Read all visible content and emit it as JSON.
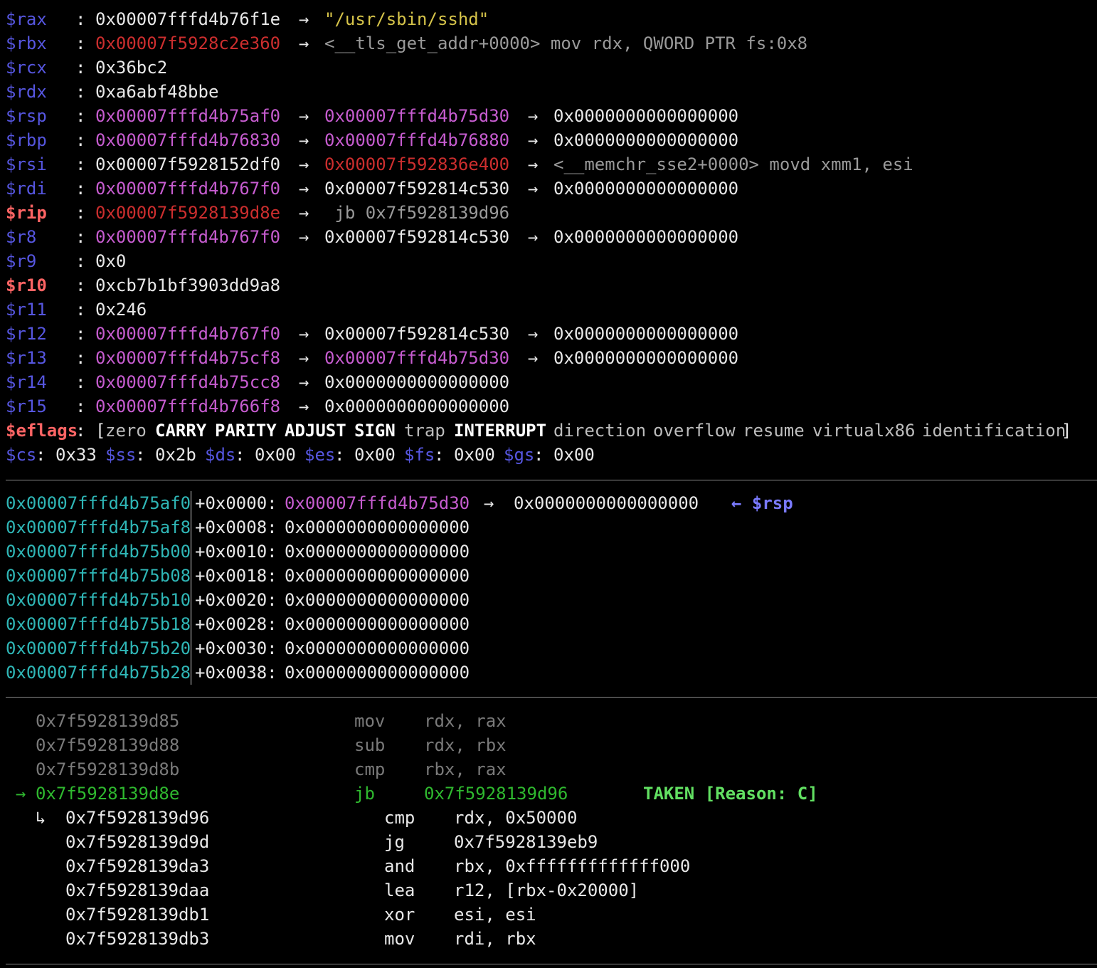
{
  "registers": [
    {
      "name": "$rax",
      "value": "0x00007fffd4b76f1e",
      "chain": [
        {
          "text": "\"/usr/sbin/sshd\"",
          "kind": "str"
        }
      ]
    },
    {
      "name": "$rbx",
      "value": "0x00007f5928c2e360",
      "vkind": "code",
      "chain": [
        {
          "text": "<__tls_get_addr+0000> mov rdx, QWORD PTR fs:0x8",
          "kind": "sym"
        }
      ]
    },
    {
      "name": "$rcx",
      "value": "0x36bc2"
    },
    {
      "name": "$rdx",
      "value": "0xa6abf48bbe"
    },
    {
      "name": "$rsp",
      "value": "0x00007fffd4b75af0",
      "vkind": "heap",
      "chain": [
        {
          "text": "0x00007fffd4b75d30",
          "kind": "heap"
        },
        {
          "text": "0x0000000000000000",
          "kind": "val"
        }
      ]
    },
    {
      "name": "$rbp",
      "value": "0x00007fffd4b76830",
      "vkind": "heap",
      "chain": [
        {
          "text": "0x00007fffd4b76880",
          "kind": "heap"
        },
        {
          "text": "0x0000000000000000",
          "kind": "val"
        }
      ]
    },
    {
      "name": "$rsi",
      "value": "0x00007f5928152df0",
      "chain": [
        {
          "text": "0x00007f592836e400",
          "kind": "code"
        },
        {
          "text": "<__memchr_sse2+0000> movd xmm1, esi",
          "kind": "sym"
        }
      ]
    },
    {
      "name": "$rdi",
      "value": "0x00007fffd4b767f0",
      "vkind": "heap",
      "chain": [
        {
          "text": "0x00007f592814c530",
          "kind": "val"
        },
        {
          "text": "0x0000000000000000",
          "kind": "val"
        }
      ]
    },
    {
      "name": "$rip",
      "value": "0x00007f5928139d8e",
      "vkind": "code",
      "highlight": true,
      "chain": [
        {
          "text": " jb 0x7f5928139d96",
          "kind": "sym"
        }
      ]
    },
    {
      "name": "$r8",
      "value": "0x00007fffd4b767f0",
      "vkind": "heap",
      "chain": [
        {
          "text": "0x00007f592814c530",
          "kind": "val"
        },
        {
          "text": "0x0000000000000000",
          "kind": "val"
        }
      ]
    },
    {
      "name": "$r9",
      "value": "0x0"
    },
    {
      "name": "$r10",
      "value": "0xcb7b1bf3903dd9a8",
      "highlight": true
    },
    {
      "name": "$r11",
      "value": "0x246"
    },
    {
      "name": "$r12",
      "value": "0x00007fffd4b767f0",
      "vkind": "heap",
      "chain": [
        {
          "text": "0x00007f592814c530",
          "kind": "val"
        },
        {
          "text": "0x0000000000000000",
          "kind": "val"
        }
      ]
    },
    {
      "name": "$r13",
      "value": "0x00007fffd4b75cf8",
      "vkind": "heap",
      "chain": [
        {
          "text": "0x00007fffd4b75d30",
          "kind": "heap"
        },
        {
          "text": "0x0000000000000000",
          "kind": "val"
        }
      ]
    },
    {
      "name": "$r14",
      "value": "0x00007fffd4b75cc8",
      "vkind": "heap",
      "chain": [
        {
          "text": "0x0000000000000000",
          "kind": "val"
        }
      ]
    },
    {
      "name": "$r15",
      "value": "0x00007fffd4b766f8",
      "vkind": "heap",
      "chain": [
        {
          "text": "0x0000000000000000",
          "kind": "val"
        }
      ]
    }
  ],
  "arrow_glyph": "→",
  "eflags": {
    "label": "$eflags",
    "flags": [
      {
        "name": "zero",
        "set": false
      },
      {
        "name": "CARRY",
        "set": true
      },
      {
        "name": "PARITY",
        "set": true
      },
      {
        "name": "ADJUST",
        "set": true
      },
      {
        "name": "SIGN",
        "set": true
      },
      {
        "name": "trap",
        "set": false
      },
      {
        "name": "INTERRUPT",
        "set": true
      },
      {
        "name": "direction",
        "set": false
      },
      {
        "name": "overflow",
        "set": false
      },
      {
        "name": "resume",
        "set": false
      },
      {
        "name": "virtualx86",
        "set": false
      },
      {
        "name": "identification",
        "set": false
      }
    ]
  },
  "segments": [
    {
      "name": "$cs",
      "value": "0x33"
    },
    {
      "name": "$ss",
      "value": "0x2b"
    },
    {
      "name": "$ds",
      "value": "0x00"
    },
    {
      "name": "$es",
      "value": "0x00"
    },
    {
      "name": "$fs",
      "value": "0x00"
    },
    {
      "name": "$gs",
      "value": "0x00"
    }
  ],
  "stack": [
    {
      "addr": "0x00007fffd4b75af0",
      "offset": "+0x0000:",
      "value": "0x00007fffd4b75d30",
      "vkind": "heap",
      "deref": "0x0000000000000000",
      "marker": "← $rsp"
    },
    {
      "addr": "0x00007fffd4b75af8",
      "offset": "+0x0008:",
      "value": "0x0000000000000000"
    },
    {
      "addr": "0x00007fffd4b75b00",
      "offset": "+0x0010:",
      "value": "0x0000000000000000"
    },
    {
      "addr": "0x00007fffd4b75b08",
      "offset": "+0x0018:",
      "value": "0x0000000000000000"
    },
    {
      "addr": "0x00007fffd4b75b10",
      "offset": "+0x0020:",
      "value": "0x0000000000000000"
    },
    {
      "addr": "0x00007fffd4b75b18",
      "offset": "+0x0028:",
      "value": "0x0000000000000000"
    },
    {
      "addr": "0x00007fffd4b75b20",
      "offset": "+0x0030:",
      "value": "0x0000000000000000"
    },
    {
      "addr": "0x00007fffd4b75b28",
      "offset": "+0x0038:",
      "value": "0x0000000000000000"
    }
  ],
  "disasm": [
    {
      "prefix": "",
      "addr": "0x7f5928139d85",
      "mnem": "mov",
      "ops": "rdx, rax",
      "state": "past"
    },
    {
      "prefix": "",
      "addr": "0x7f5928139d88",
      "mnem": "sub",
      "ops": "rdx, rbx",
      "state": "past"
    },
    {
      "prefix": "",
      "addr": "0x7f5928139d8b",
      "mnem": "cmp",
      "ops": "rbx, rax",
      "state": "past"
    },
    {
      "prefix": "→",
      "addr": "0x7f5928139d8e",
      "mnem": "jb",
      "ops": "0x7f5928139d96",
      "state": "current",
      "note": "TAKEN [Reason: C]"
    },
    {
      "prefix": "↳",
      "addr": "0x7f5928139d96",
      "mnem": "cmp",
      "ops": "rdx, 0x50000",
      "state": "target"
    },
    {
      "prefix": "",
      "addr": "0x7f5928139d9d",
      "mnem": "jg",
      "ops": "0x7f5928139eb9",
      "state": "target"
    },
    {
      "prefix": "",
      "addr": "0x7f5928139da3",
      "mnem": "and",
      "ops": "rbx, 0xfffffffffffff000",
      "state": "target"
    },
    {
      "prefix": "",
      "addr": "0x7f5928139daa",
      "mnem": "lea",
      "ops": "r12, [rbx-0x20000]",
      "state": "target"
    },
    {
      "prefix": "",
      "addr": "0x7f5928139db1",
      "mnem": "xor",
      "ops": "esi, esi",
      "state": "target"
    },
    {
      "prefix": "",
      "addr": "0x7f5928139db3",
      "mnem": "mov",
      "ops": "rdi, rbx",
      "state": "target"
    }
  ]
}
